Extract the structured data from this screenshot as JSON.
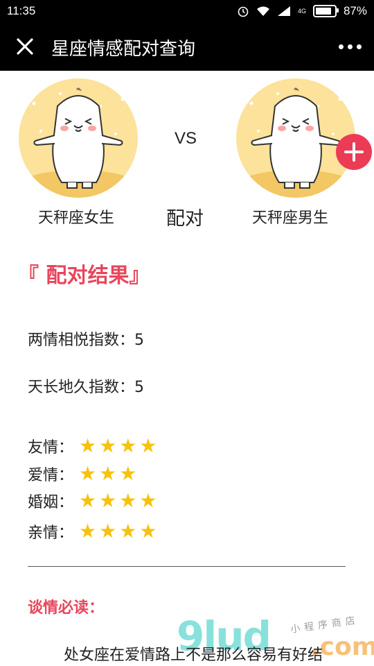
{
  "status_bar": {
    "time": "11:35",
    "network": "4G",
    "battery": "87%",
    "battery_level": 0.87
  },
  "header": {
    "title": "星座情感配对查询",
    "close_icon": "close-icon",
    "more_icon": "more-dots-icon"
  },
  "pairing": {
    "left_name": "天秤座女生",
    "right_name": "天秤座男生",
    "vs_label": "VS",
    "pair_label": "配对",
    "add_icon": "plus-icon"
  },
  "result": {
    "title": "『 配对结果』",
    "metrics": [
      {
        "label": "两情相悦指数：5"
      },
      {
        "label": "天长地久指数：5"
      }
    ],
    "ratings": [
      {
        "label": "友情：",
        "stars": 4
      },
      {
        "label": "爱情：",
        "stars": 3
      },
      {
        "label": "婚姻：",
        "stars": 4
      },
      {
        "label": "亲情：",
        "stars": 4
      }
    ]
  },
  "section": {
    "title": "谈情必读：",
    "text": "处女座在爱情路上不是那么容易有好结"
  },
  "watermark": {
    "main": "9lud",
    "dot": ".com",
    "sub": "小程序商店"
  },
  "colors": {
    "accent": "#e8465c",
    "star": "#f6c20d",
    "avatar_bg": "#fce29a",
    "add_button": "#ec3b55"
  }
}
